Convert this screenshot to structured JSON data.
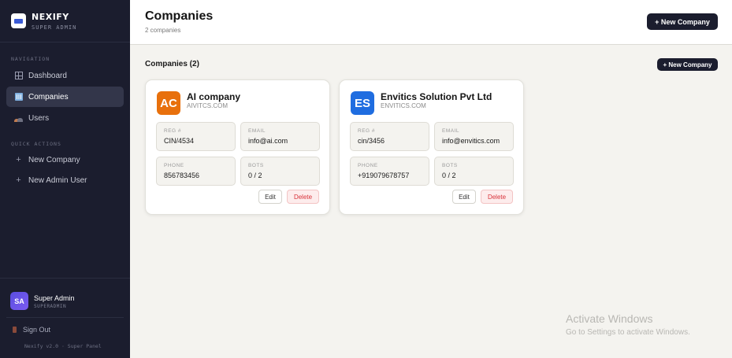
{
  "brand": {
    "name": "NEXIFY",
    "subtitle": "SUPER ADMIN"
  },
  "sidebar": {
    "navigation_label": "NAVIGATION",
    "nav_items": [
      {
        "label": "Dashboard",
        "icon": "grid-icon",
        "active": false
      },
      {
        "label": "Companies",
        "icon": "building-icon",
        "active": true
      },
      {
        "label": "Users",
        "icon": "users-icon",
        "active": false
      }
    ],
    "quick_actions_label": "QUICK ACTIONS",
    "quick_actions": [
      {
        "label": "New Company",
        "icon": "plus-icon"
      },
      {
        "label": "New Admin User",
        "icon": "plus-icon"
      }
    ],
    "user": {
      "initials": "SA",
      "name": "Super Admin",
      "role": "SUPERADMIN"
    },
    "sign_out_label": "Sign Out",
    "version": "Nexify v2.0 · Super Panel"
  },
  "header": {
    "title": "Companies",
    "subtitle": "2 companies",
    "new_company_label": "+ New Company"
  },
  "main": {
    "section_title": "Companies (2)",
    "new_company_label": "+ New Company",
    "companies": [
      {
        "initials": "AC",
        "avatar_color": "#e8700c",
        "name": "AI company",
        "domain": "AIVITCS.COM",
        "reg_label": "REG #",
        "reg": "CIN/4534",
        "email_label": "EMAIL",
        "email": "info@ai.com",
        "phone_label": "PHONE",
        "phone": "856783456",
        "bots_label": "BOTS",
        "bots": "0 / 2",
        "edit_label": "Edit",
        "delete_label": "Delete"
      },
      {
        "initials": "ES",
        "avatar_color": "#1f6de0",
        "name": "Envitics Solution Pvt Ltd",
        "domain": "ENVITICS.COM",
        "reg_label": "REG #",
        "reg": "cin/3456",
        "email_label": "EMAIL",
        "email": "info@envitics.com",
        "phone_label": "PHONE",
        "phone": "+919079678757",
        "bots_label": "BOTS",
        "bots": "0 / 2",
        "edit_label": "Edit",
        "delete_label": "Delete"
      }
    ]
  },
  "watermark": {
    "title": "Activate Windows",
    "subtitle": "Go to Settings to activate Windows."
  },
  "colors": {
    "sidebar_bg": "#1b1d2e",
    "accent_dark": "#1b1d2e",
    "delete_red": "#d8323a",
    "page_bg": "#f4f3ef"
  }
}
